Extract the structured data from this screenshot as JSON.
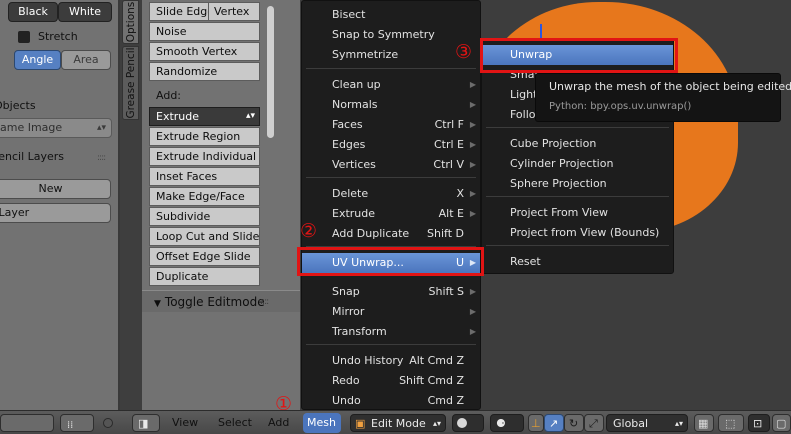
{
  "left_panel": {
    "black_label": "Black",
    "white_label": "White",
    "stretch_label": "Stretch",
    "angle_label": "Angle",
    "area_label": "Area",
    "objects_label": "Objects",
    "same_image_label": "Same Image",
    "pencil_layers_label": "Pencil Layers",
    "new_button": "New",
    "new_layer_button": "New Layer"
  },
  "tabs": {
    "options": "Options",
    "grease_pencil": "Grease Pencil"
  },
  "tool_shelf": {
    "buttons_top": [
      "Slide Edge",
      "Noise",
      "Smooth Vertex",
      "Randomize"
    ],
    "vertex_label": "Vertex",
    "add_label": "Add:",
    "buttons_add": [
      "Extrude",
      "Extrude Region",
      "Extrude Individual",
      "Inset Faces",
      "Make Edge/Face",
      "Subdivide",
      "Loop Cut and Slide",
      "Offset Edge Slide",
      "Duplicate"
    ],
    "toggle_editmode": "Toggle Editmode"
  },
  "mesh_menu": {
    "items": [
      {
        "label": "Bisect",
        "shortcut": "",
        "arrow": false
      },
      {
        "label": "Snap to Symmetry",
        "shortcut": "",
        "arrow": false
      },
      {
        "label": "Symmetrize",
        "shortcut": "",
        "arrow": false
      },
      {
        "label": "Clean up",
        "shortcut": "",
        "arrow": true
      },
      {
        "label": "Normals",
        "shortcut": "",
        "arrow": true
      },
      {
        "label": "Faces",
        "shortcut": "Ctrl F",
        "arrow": true
      },
      {
        "label": "Edges",
        "shortcut": "Ctrl E",
        "arrow": true
      },
      {
        "label": "Vertices",
        "shortcut": "Ctrl V",
        "arrow": true
      },
      {
        "label": "Delete",
        "shortcut": "X",
        "arrow": true
      },
      {
        "label": "Extrude",
        "shortcut": "Alt E",
        "arrow": true
      },
      {
        "label": "Add Duplicate",
        "shortcut": "Shift D",
        "arrow": false
      },
      {
        "label": "UV Unwrap...",
        "shortcut": "U",
        "arrow": true
      },
      {
        "label": "Snap",
        "shortcut": "Shift S",
        "arrow": true
      },
      {
        "label": "Mirror",
        "shortcut": "",
        "arrow": true
      },
      {
        "label": "Transform",
        "shortcut": "",
        "arrow": true
      },
      {
        "label": "Undo History",
        "shortcut": "Alt Cmd Z",
        "arrow": false
      },
      {
        "label": "Redo",
        "shortcut": "Shift Cmd Z",
        "arrow": false
      },
      {
        "label": "Undo",
        "shortcut": "Cmd Z",
        "arrow": false
      }
    ]
  },
  "uv_menu": {
    "items": [
      {
        "label": "Unwrap"
      },
      {
        "label": "Smart UV Project"
      },
      {
        "label": "Lightmap Pack"
      },
      {
        "label": "Follow Active Quads"
      },
      {
        "label": "Cube Projection"
      },
      {
        "label": "Cylinder Projection"
      },
      {
        "label": "Sphere Projection"
      },
      {
        "label": "Project From View"
      },
      {
        "label": "Project from View (Bounds)"
      },
      {
        "label": "Reset"
      }
    ]
  },
  "tooltip": {
    "description": "Unwrap the mesh of the object being edited",
    "python": "Python: bpy.ops.uv.unwrap()"
  },
  "annotations": {
    "step1": "①",
    "step2": "②",
    "step3": "③"
  },
  "header": {
    "view": "View",
    "select": "Select",
    "add": "Add",
    "mesh": "Mesh",
    "mode": "Edit Mode",
    "orientation": "Global"
  },
  "colors": {
    "highlight": "#4b75bd",
    "annotation_red": "#e11414",
    "object_orange": "#f07a1a"
  }
}
